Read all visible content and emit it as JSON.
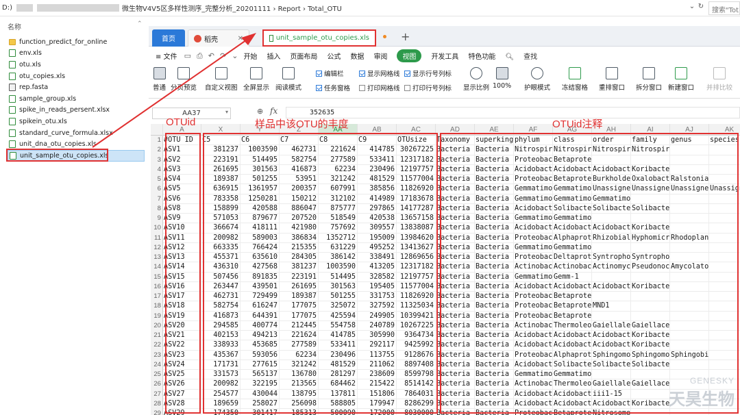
{
  "explorer": {
    "drive": "D:)",
    "breadcrumb": "微生物V4V5区多样性测序_完整分析_20201111  ›  Report  ›  Total_OTU",
    "search_placeholder": "搜索\"Tot",
    "nav_header": "名称",
    "files": [
      {
        "name": "function_predict_for_online",
        "icon": "folder-icon"
      },
      {
        "name": "env.xls",
        "icon": "spreadsheet-icon"
      },
      {
        "name": "otu.xls",
        "icon": "spreadsheet-icon"
      },
      {
        "name": "otu_copies.xls",
        "icon": "spreadsheet-icon"
      },
      {
        "name": "rep.fasta",
        "icon": "fasta-file-icon"
      },
      {
        "name": "sample_group.xls",
        "icon": "spreadsheet-icon"
      },
      {
        "name": "spike_in_reads_persent.xlsx",
        "icon": "spreadsheet-icon"
      },
      {
        "name": "spikein_otu.xls",
        "icon": "spreadsheet-icon"
      },
      {
        "name": "standard_curve_formula.xlsx",
        "icon": "spreadsheet-icon"
      },
      {
        "name": "unit_dna_otu_copies.xls",
        "icon": "spreadsheet-icon"
      },
      {
        "name": "unit_sample_otu_copies.xls",
        "icon": "spreadsheet-icon",
        "selected": true
      }
    ]
  },
  "tabs": {
    "home": "首页",
    "docer": "稻壳",
    "file": "unit_sample_otu_copies.xls",
    "add": "+"
  },
  "menu": {
    "file": "≡ 文件",
    "items": [
      "开始",
      "插入",
      "页面布局",
      "公式",
      "数据",
      "审阅"
    ],
    "active": "视图",
    "after": [
      "开发工具",
      "特色功能"
    ],
    "find": "查找"
  },
  "ribbon": {
    "normal": "普通",
    "page_break": "分页预览",
    "custom_view": "自定义视图",
    "fullscreen": "全屏显示",
    "reading_mode": "阅读模式",
    "formula_bar": "编辑栏",
    "show_grid": "显示网格线",
    "show_rowcol": "显示行号列标",
    "task_pane": "任务窗格",
    "print_grid": "打印网格线",
    "print_rowcol": "打印行号列标",
    "zoom": "显示比例",
    "zoom_100": "100%",
    "eye_mode": "护眼模式",
    "freeze": "冻结窗格",
    "arrange": "重排窗口",
    "split": "拆分窗口",
    "new_window": "新建窗口",
    "compare": "并排比较"
  },
  "formula": {
    "cell": "AA37",
    "fx": "fx",
    "value": "352635"
  },
  "annotations": {
    "otuid": "OTUid",
    "abundance": "样品中该OTU的丰度",
    "taxonomy": "OTUid注释"
  },
  "watermark": {
    "line1": "GENESKY",
    "line2": "天昊生物"
  },
  "sheet": {
    "col_letters": [
      "A",
      "X",
      "Y",
      "Z",
      "AA",
      "AB",
      "AC",
      "AD",
      "AE",
      "AF",
      "AG",
      "AH",
      "AI",
      "AJ",
      "AK"
    ],
    "headers": [
      "#OTU ID",
      "C5",
      "C6",
      "C7",
      "C8",
      "C9",
      "OTUsize",
      "Taxonomy",
      "superkingdom",
      "phylum",
      "class",
      "order",
      "family",
      "genus",
      "species"
    ],
    "rows": [
      [
        "ASV1",
        "381237",
        "1003590",
        "462731",
        "221624",
        "414785",
        "30267225",
        "Bacteria",
        "Bacteria",
        "Nitrospirae",
        "Nitrospira",
        "Nitrospirales",
        "Nitrospiraceae",
        "",
        ""
      ],
      [
        "ASV2",
        "223191",
        "514495",
        "582754",
        "277589",
        "533411",
        "12317182",
        "Bacteria",
        "Bacteria",
        "Proteobacteria",
        "Betaproteobacteria",
        "",
        "",
        "",
        ""
      ],
      [
        "ASV3",
        "261695",
        "301563",
        "416873",
        "62234",
        "230496",
        "12197757",
        "Bacteria",
        "Bacteria",
        "Acidobacteria",
        "Acidobacteria",
        "Acidobacteria",
        "Koribacteraceae",
        "",
        ""
      ],
      [
        "ASV4",
        "189387",
        "501255",
        "53951",
        "321242",
        "481529",
        "11577004",
        "Bacteria",
        "Bacteria",
        "Proteobacteria",
        "Betaproteobacteria",
        "Burkholderiales",
        "Oxalobacteraceae",
        "Ralstonia",
        ""
      ],
      [
        "ASV5",
        "636915",
        "1361957",
        "200357",
        "607991",
        "385856",
        "11826920",
        "Bacteria",
        "Bacteria",
        "Gemmatimonadetes",
        "Gemmatimonadetes",
        "Unassigned",
        "Unassigned",
        "Unassigned",
        "Unassigned"
      ],
      [
        "ASV6",
        "783358",
        "1250281",
        "150212",
        "312102",
        "414989",
        "17183678",
        "Bacteria",
        "Bacteria",
        "Gemmatimonadetes",
        "Gemmatimonadetes",
        "Gemmatimonadales",
        "",
        "",
        ""
      ],
      [
        "ASV8",
        "158899",
        "420588",
        "886047",
        "875777",
        "297865",
        "14177287",
        "Bacteria",
        "Bacteria",
        "Acidobacteria",
        "Solibacteres",
        "Solibacterales",
        "Solibacteraceae",
        "",
        ""
      ],
      [
        "ASV9",
        "571053",
        "879677",
        "207520",
        "518549",
        "420538",
        "13657158",
        "Bacteria",
        "Bacteria",
        "Gemmatimonadetes",
        "Gemmatimonadetes",
        "",
        "",
        "",
        ""
      ],
      [
        "ASV10",
        "366674",
        "418111",
        "421980",
        "757692",
        "309557",
        "13838087",
        "Bacteria",
        "Bacteria",
        "Acidobacteria",
        "Acidobacteria",
        "Acidobacteria",
        "Koribacteraceae",
        "",
        ""
      ],
      [
        "ASV11",
        "200982",
        "589003",
        "386834",
        "1352712",
        "195009",
        "13984620",
        "Bacteria",
        "Bacteria",
        "Proteobacteria",
        "Alphaproteobacteria",
        "Rhizobiales",
        "Hyphomicrobiaceae",
        "Rhodoplanes",
        ""
      ],
      [
        "ASV12",
        "663335",
        "766424",
        "215355",
        "631229",
        "495252",
        "13413627",
        "Bacteria",
        "Bacteria",
        "Gemmatimonadetes",
        "Gemmatimonadetes",
        "",
        "",
        "",
        ""
      ],
      [
        "ASV13",
        "455371",
        "635610",
        "284305",
        "386142",
        "338491",
        "12869656",
        "Bacteria",
        "Bacteria",
        "Proteobacteria",
        "Deltaproteobacteria",
        "Syntrophobacterales",
        "Syntrophobacteraceae",
        "",
        ""
      ],
      [
        "ASV14",
        "436310",
        "427568",
        "381237",
        "1003590",
        "413205",
        "12317182",
        "Bacteria",
        "Bacteria",
        "Actinobacteria",
        "Actinobacteria",
        "Actinomycetales",
        "Pseudonocardiaceae",
        "Amycolatopsis",
        ""
      ],
      [
        "ASV15",
        "507456",
        "891835",
        "223191",
        "514495",
        "328582",
        "12197757",
        "Bacteria",
        "Bacteria",
        "Gemmatimonadetes",
        "Gemm-1",
        "",
        "",
        "",
        ""
      ],
      [
        "ASV16",
        "263447",
        "439501",
        "261695",
        "301563",
        "195405",
        "11577004",
        "Bacteria",
        "Bacteria",
        "Acidobacteria",
        "Acidobacteria",
        "Acidobacteria",
        "Koribacteraceae",
        "",
        ""
      ],
      [
        "ASV17",
        "462731",
        "729499",
        "189387",
        "501255",
        "331753",
        "11826920",
        "Bacteria",
        "Bacteria",
        "Proteobacteria",
        "Betaproteobacteria",
        "",
        "",
        "",
        ""
      ],
      [
        "ASV18",
        "582754",
        "616247",
        "177075",
        "325072",
        "327592",
        "11325034",
        "Bacteria",
        "Bacteria",
        "Proteobacteria",
        "Betaproteobacteria",
        "MND1",
        "",
        "",
        ""
      ],
      [
        "ASV19",
        "416873",
        "644391",
        "177075",
        "425594",
        "249905",
        "10399421",
        "Bacteria",
        "Bacteria",
        "Proteobacteria",
        "Betaproteobacteria",
        "",
        "",
        "",
        ""
      ],
      [
        "ASV20",
        "294585",
        "400774",
        "212445",
        "554758",
        "240789",
        "10267225",
        "Bacteria",
        "Bacteria",
        "Actinobacteria",
        "Thermoleophilia",
        "Gaiellales",
        "Gaiellaceae",
        "",
        ""
      ],
      [
        "ASV21",
        "402153",
        "494213",
        "221624",
        "414785",
        "305990",
        "9364734",
        "Bacteria",
        "Bacteria",
        "Acidobacteria",
        "Acidobacteria",
        "Acidobacteria",
        "Koribacteraceae",
        "",
        ""
      ],
      [
        "ASV22",
        "338933",
        "453685",
        "277589",
        "533411",
        "292117",
        "9425992",
        "Bacteria",
        "Bacteria",
        "Acidobacteria",
        "Acidobacteria",
        "Acidobacteria",
        "Koribacteraceae",
        "",
        ""
      ],
      [
        "ASV23",
        "435367",
        "593056",
        "62234",
        "230496",
        "113755",
        "9128676",
        "Bacteria",
        "Bacteria",
        "Proteobacteria",
        "Alphaproteobacteria",
        "Sphingomonadales",
        "Sphingomonadaceae",
        "Sphingobium",
        ""
      ],
      [
        "ASV24",
        "171731",
        "277615",
        "321242",
        "481529",
        "211062",
        "8897408",
        "Bacteria",
        "Bacteria",
        "Acidobacteria",
        "Solibacteres",
        "Solibacterales",
        "Solibacteraceae",
        "",
        ""
      ],
      [
        "ASV25",
        "331573",
        "565137",
        "136780",
        "281297",
        "238609",
        "8599798",
        "Bacteria",
        "Bacteria",
        "Gemmatimonadetes",
        "Gemmatimonadetes",
        "",
        "",
        "",
        ""
      ],
      [
        "ASV26",
        "200982",
        "322195",
        "213565",
        "684462",
        "215422",
        "8514142",
        "Bacteria",
        "Bacteria",
        "Actinobacteria",
        "Thermoleophilia",
        "Gaiellales",
        "Gaiellaceae",
        "",
        ""
      ],
      [
        "ASV27",
        "254577",
        "430044",
        "138795",
        "137811",
        "151806",
        "7864031",
        "Bacteria",
        "Bacteria",
        "Acidobacteria",
        "Acidobacteria",
        "iii1-15",
        "",
        "",
        ""
      ],
      [
        "ASV28",
        "189659",
        "258027",
        "256098",
        "588805",
        "179947",
        "8286299",
        "Bacteria",
        "Bacteria",
        "Acidobacteria",
        "Acidobacteria",
        "Acidobacteria",
        "Koribacteraceae",
        "",
        ""
      ],
      [
        "ASV29",
        "174350",
        "301417",
        "185313",
        "500090",
        "172000",
        "8030000",
        "Bacteria",
        "Bacteria",
        "Proteobacteria",
        "Betaproteobacteria",
        "Nitrosomonadales",
        "",
        "",
        ""
      ]
    ]
  }
}
